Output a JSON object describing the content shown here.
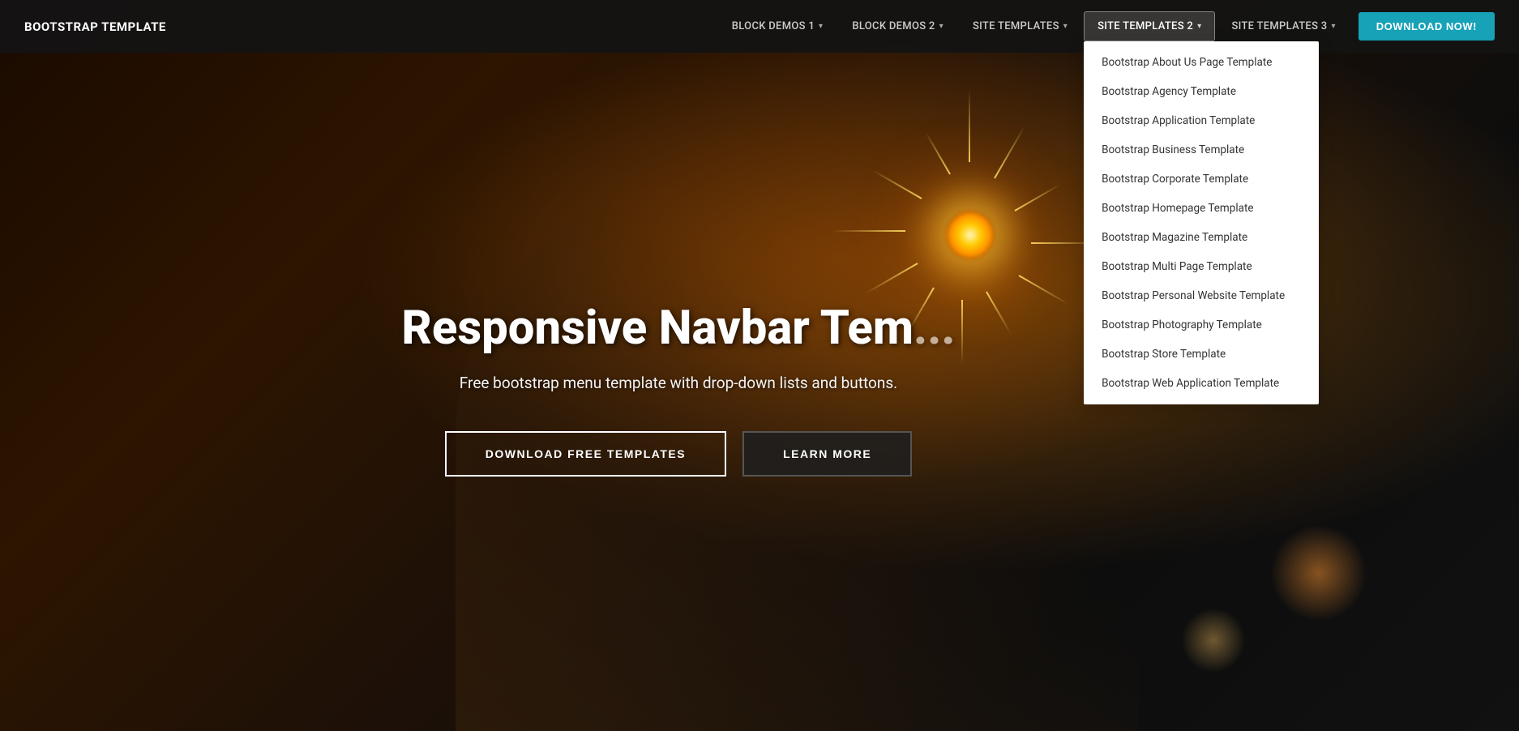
{
  "brand": {
    "label": "BOOTSTRAP TEMPLATE"
  },
  "nav": {
    "links": [
      {
        "id": "block-demos-1",
        "label": "BLOCK DEMOS 1",
        "has_dropdown": true,
        "active": false
      },
      {
        "id": "block-demos-2",
        "label": "BLOCK DEMOS 2",
        "has_dropdown": true,
        "active": false
      },
      {
        "id": "site-templates",
        "label": "SITE TEMPLATES",
        "has_dropdown": true,
        "active": false
      },
      {
        "id": "site-templates-2",
        "label": "SITE TEMPLATES 2",
        "has_dropdown": true,
        "active": true
      },
      {
        "id": "site-templates-3",
        "label": "SITE TEMPLATES 3",
        "has_dropdown": true,
        "active": false
      }
    ],
    "download_button": "DOWNLOAD NOW!"
  },
  "dropdown": {
    "items": [
      "Bootstrap About Us Page Template",
      "Bootstrap Agency Template",
      "Bootstrap Application Template",
      "Bootstrap Business Template",
      "Bootstrap Corporate Template",
      "Bootstrap Homepage Template",
      "Bootstrap Magazine Template",
      "Bootstrap Multi Page Template",
      "Bootstrap Personal Website Template",
      "Bootstrap Photography Template",
      "Bootstrap Store Template",
      "Bootstrap Web Application Template"
    ]
  },
  "hero": {
    "title": "Responsive Navbar Tem...",
    "subtitle": "Free bootstrap menu template with drop-down lists and buttons.",
    "btn_primary": "DOWNLOAD FREE TEMPLATES",
    "btn_secondary": "LEARN MORE"
  },
  "colors": {
    "accent": "#17a2b8",
    "nav_bg": "rgba(20,20,20,0.92)",
    "active_border": "rgba(255,255,255,0.4)"
  }
}
